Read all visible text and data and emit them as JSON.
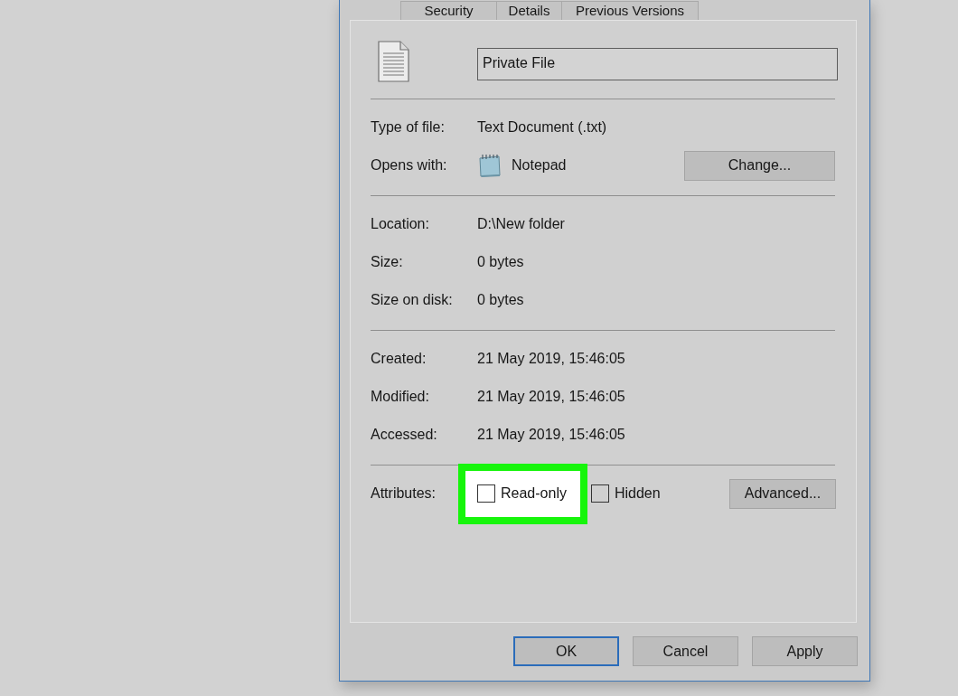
{
  "tabs": [
    {
      "label": "Security",
      "selected": false
    },
    {
      "label": "Details",
      "selected": false
    },
    {
      "label": "Previous Versions",
      "selected": false
    }
  ],
  "general": {
    "file_name": "Private File",
    "sections": [
      {
        "rows": [
          {
            "kind": "text",
            "label": "Type of file:",
            "value": "Text Document (.txt)"
          },
          {
            "kind": "app",
            "label": "Opens with:",
            "value": "Notepad",
            "button": "Change..."
          }
        ]
      },
      {
        "rows": [
          {
            "kind": "text",
            "label": "Location:",
            "value": "D:\\New folder"
          },
          {
            "kind": "text",
            "label": "Size:",
            "value": "0 bytes"
          },
          {
            "kind": "text",
            "label": "Size on disk:",
            "value": "0 bytes"
          }
        ]
      },
      {
        "rows": [
          {
            "kind": "text",
            "label": "Created:",
            "value": "21 May 2019, 15:46:05"
          },
          {
            "kind": "text",
            "label": "Modified:",
            "value": "21 May 2019, 15:46:05"
          },
          {
            "kind": "text",
            "label": "Accessed:",
            "value": "21 May 2019, 15:46:05"
          }
        ]
      }
    ]
  },
  "attributes": {
    "label": "Attributes:",
    "items": [
      {
        "label": "Read-only",
        "checked": false,
        "highlighted": true
      },
      {
        "label": "Hidden",
        "checked": false,
        "highlighted": false
      }
    ],
    "button": "Advanced..."
  },
  "buttons": [
    {
      "label": "OK",
      "default": true
    },
    {
      "label": "Cancel",
      "default": false
    },
    {
      "label": "Apply",
      "default": false
    }
  ]
}
